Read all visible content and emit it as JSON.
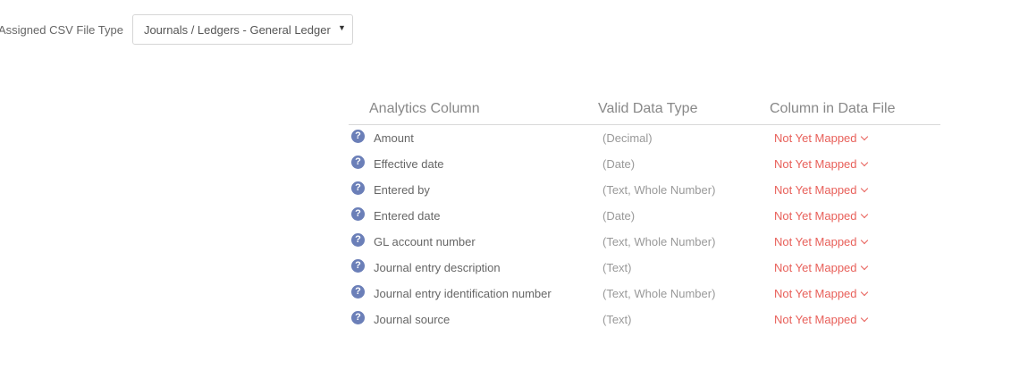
{
  "file_type": {
    "label": "Assigned CSV File Type",
    "selected": "Journals / Ledgers - General Ledger",
    "caret": "▼"
  },
  "table": {
    "headers": {
      "analytics_column": "Analytics Column",
      "valid_data_type": "Valid Data Type",
      "column_in_data_file": "Column in Data File"
    },
    "help_glyph": "?",
    "rows": [
      {
        "name": "Amount",
        "type": "(Decimal)",
        "mapping": "Not Yet Mapped"
      },
      {
        "name": "Effective date",
        "type": "(Date)",
        "mapping": "Not Yet Mapped"
      },
      {
        "name": "Entered by",
        "type": "(Text, Whole Number)",
        "mapping": "Not Yet Mapped"
      },
      {
        "name": "Entered date",
        "type": "(Date)",
        "mapping": "Not Yet Mapped"
      },
      {
        "name": "GL account number",
        "type": "(Text, Whole Number)",
        "mapping": "Not Yet Mapped"
      },
      {
        "name": "Journal entry description",
        "type": "(Text)",
        "mapping": "Not Yet Mapped"
      },
      {
        "name": "Journal entry identification number",
        "type": "(Text, Whole Number)",
        "mapping": "Not Yet Mapped"
      },
      {
        "name": "Journal source",
        "type": "(Text)",
        "mapping": "Not Yet Mapped"
      }
    ]
  },
  "colors": {
    "accent_unmapped": "#e8605a",
    "help_icon": "#6b7fb8"
  }
}
